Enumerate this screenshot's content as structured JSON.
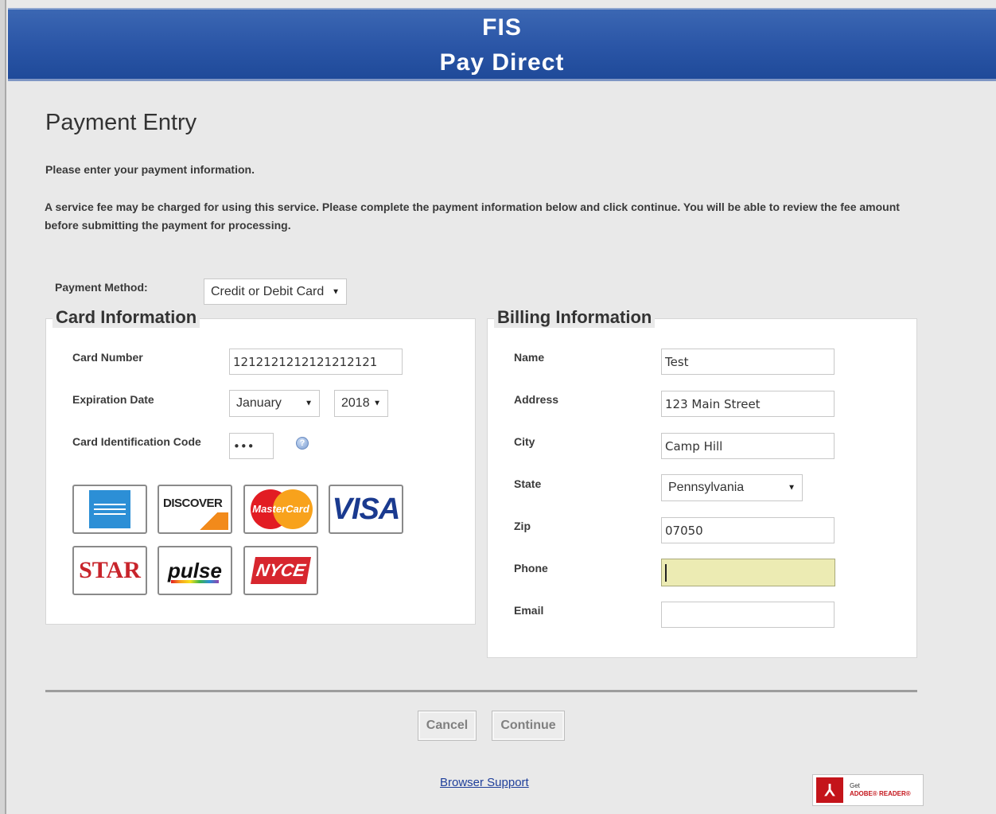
{
  "header": {
    "line1": "FIS",
    "line2": "Pay Direct"
  },
  "page": {
    "title": "Payment Entry",
    "intro": "Please enter your payment information.",
    "fee_notice": "A service fee may be charged for using this service. Please complete the payment information below and click continue. You will be able to review the fee amount before submitting the payment for processing."
  },
  "payment_method": {
    "label": "Payment Method:",
    "value": "Credit or Debit Card"
  },
  "card": {
    "title": "Card Information",
    "number_label": "Card Number",
    "number_value": "1212121212121212121",
    "expiration_label": "Expiration Date",
    "exp_month": "January",
    "exp_year": "2018",
    "cid_label": "Card Identification Code",
    "cid_value": "•••",
    "help_icon": "help-icon",
    "logos": {
      "discover": "DISCOVER",
      "mastercard": "MasterCard",
      "visa": "VISA",
      "star": "STAR",
      "pulse": "pulse",
      "nyce": "NYCE"
    }
  },
  "billing": {
    "title": "Billing Information",
    "name_label": "Name",
    "name_value": "Test",
    "address_label": "Address",
    "address_value": "123 Main Street",
    "city_label": "City",
    "city_value": "Camp Hill",
    "state_label": "State",
    "state_value": "Pennsylvania",
    "zip_label": "Zip",
    "zip_value": "07050",
    "phone_label": "Phone",
    "phone_value": "",
    "email_label": "Email",
    "email_value": ""
  },
  "buttons": {
    "cancel": "Cancel",
    "continue": "Continue"
  },
  "footer": {
    "browser_support": "Browser Support",
    "adobe_line1": "Get",
    "adobe_line2": "ADOBE® READER®"
  },
  "colors": {
    "header_blue": "#2a55a6",
    "focused_field": "#ecebb3",
    "link": "#1f3f9a"
  }
}
